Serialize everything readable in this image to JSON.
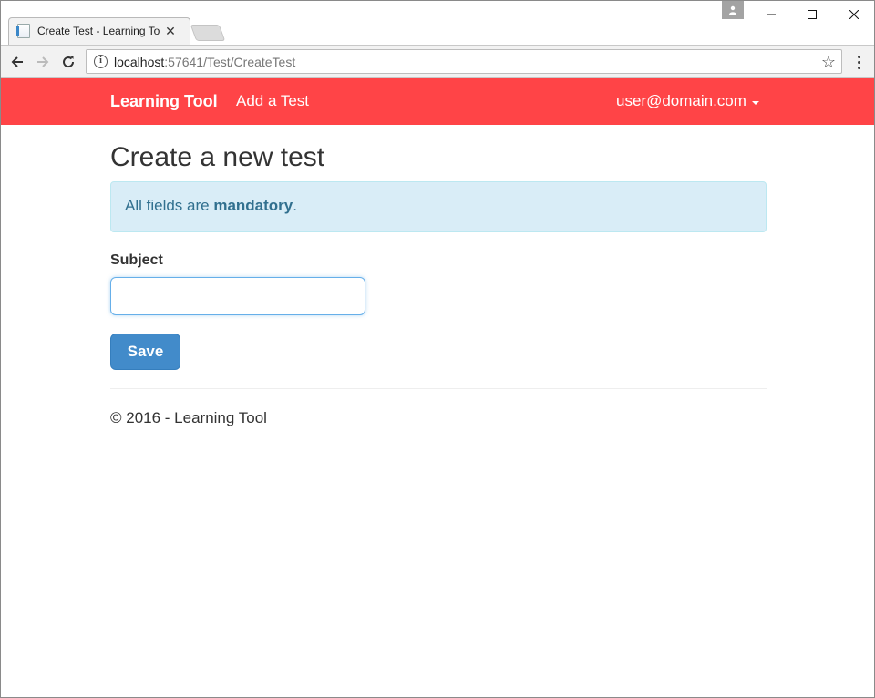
{
  "browser": {
    "tab_title": "Create Test - Learning To",
    "tab_close": "✕",
    "url_host": "localhost",
    "url_rest": ":57641/Test/CreateTest",
    "info_icon": "i",
    "star_icon": "☆"
  },
  "navbar": {
    "brand": "Learning Tool",
    "add_test": "Add a Test",
    "user": "user@domain.com",
    "background": "#ff4447"
  },
  "main": {
    "title": "Create a new test",
    "alert_prefix": "All fields are ",
    "alert_strong": "mandatory",
    "alert_suffix": ".",
    "subject_label": "Subject",
    "subject_value": "",
    "save_label": "Save"
  },
  "footer": {
    "text": "© 2016 - Learning Tool"
  },
  "colors": {
    "primary": "#428bca",
    "alert_bg": "#d9edf7",
    "alert_text": "#31708f"
  }
}
